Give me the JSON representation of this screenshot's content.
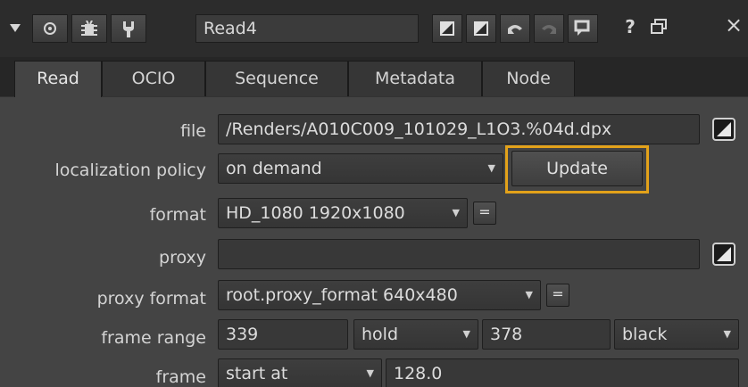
{
  "toolbar": {
    "node_name": "Read4",
    "icons": [
      "collapse-triangle-icon",
      "center-circle-icon",
      "bug-icon",
      "tool-icon",
      "split-icon",
      "split-icon",
      "undo-icon",
      "redo-icon",
      "revert-icon",
      "help-icon",
      "float-window-icon",
      "close-icon"
    ],
    "help_glyph": "?",
    "close_glyph": "×"
  },
  "tabs": [
    {
      "label": "Read",
      "active": true
    },
    {
      "label": "OCIO",
      "active": false
    },
    {
      "label": "Sequence",
      "active": false
    },
    {
      "label": "Metadata",
      "active": false
    },
    {
      "label": "Node",
      "active": false
    }
  ],
  "knobs": {
    "file": {
      "label": "file",
      "value": "/Renders/A010C009_101029_L1O3.%04d.dpx"
    },
    "localization": {
      "label": "localization policy",
      "value": "on demand",
      "button": "Update"
    },
    "format": {
      "label": "format",
      "value": "HD_1080 1920x1080",
      "eq": "="
    },
    "proxy": {
      "label": "proxy",
      "value": ""
    },
    "proxy_format": {
      "label": "proxy format",
      "value": "root.proxy_format 640x480",
      "eq": "="
    },
    "frame_range": {
      "label": "frame range",
      "first": "339",
      "before": "hold",
      "last": "378",
      "after": "black"
    },
    "frame": {
      "label": "frame",
      "mode": "start at",
      "value": "128.0"
    }
  },
  "colors": {
    "highlight": "#e3a21a",
    "panel": "#444444",
    "field": "#383838"
  }
}
